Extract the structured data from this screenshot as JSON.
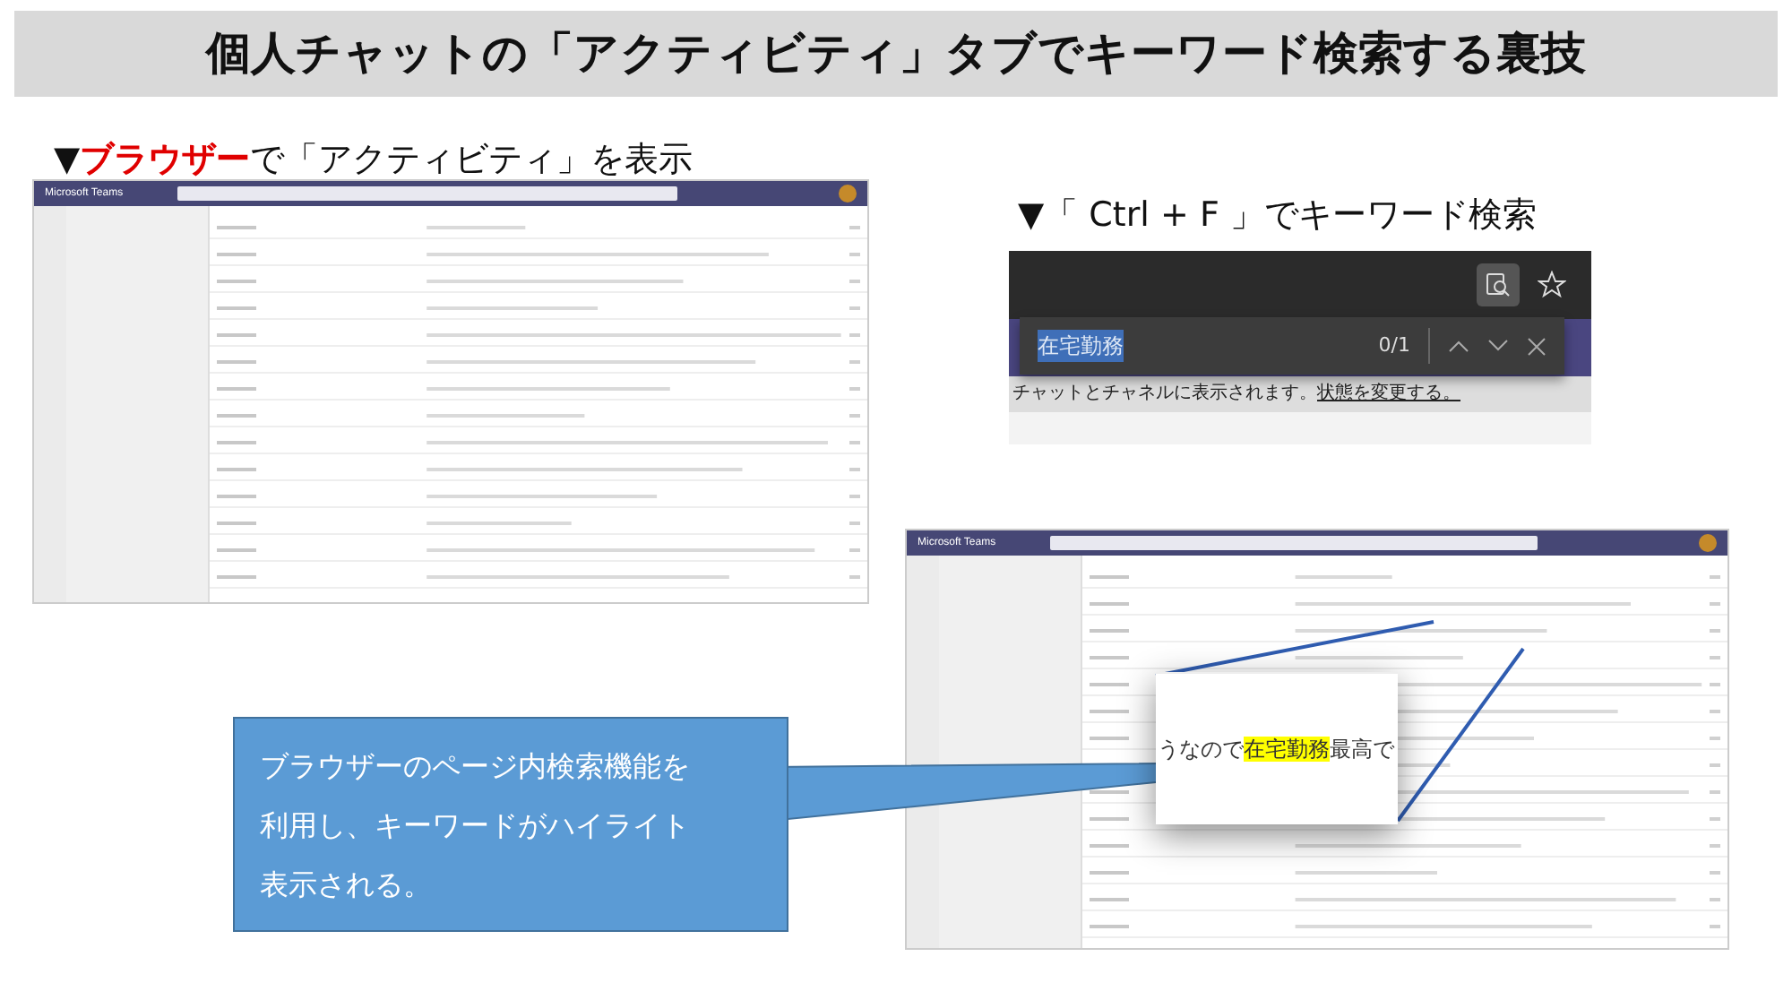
{
  "title": "個人チャットの「アクティビティ」タブでキーワード検索する裏技",
  "captions": [
    {
      "parts": [
        {
          "text": "▼",
          "emphasis": false
        },
        {
          "text": "ブラウザー",
          "emphasis": true
        },
        {
          "text": "で「アクティビティ」を表示",
          "emphasis": false
        }
      ]
    },
    {
      "parts": [
        {
          "text": "▼「 Ctrl + F 」でキーワード検索",
          "emphasis": false
        }
      ]
    }
  ],
  "screenshots": [
    {
      "app_name": "Microsoft Teams"
    },
    {
      "app_name": "Microsoft Teams"
    }
  ],
  "find_bar": {
    "query": "在宅勤務",
    "count": "0/1",
    "notice": "チャットとチャネルに表示されます。",
    "notice_link": "状態を変更する。"
  },
  "zoom_inset": {
    "before": "うなので",
    "match": "在宅勤務",
    "after": "最高で"
  },
  "callout": {
    "lines": [
      "ブラウザーのページ内検索機能を",
      "利用し、キーワードがハイライト",
      "表示される。"
    ]
  }
}
